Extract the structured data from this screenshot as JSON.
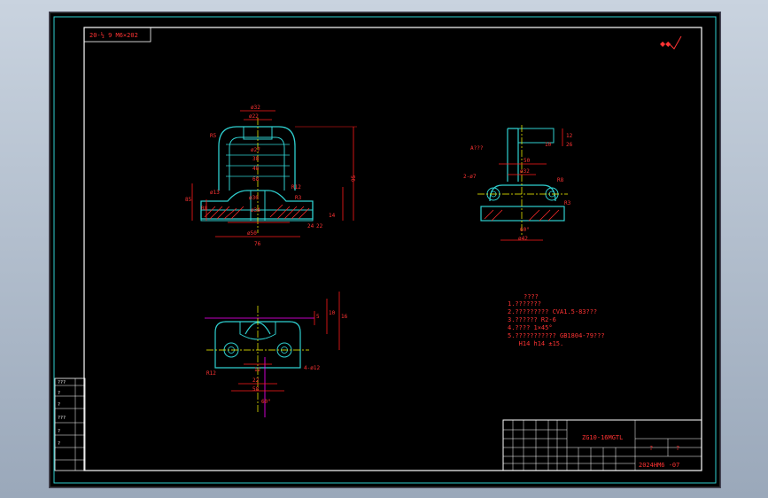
{
  "stamp_top_left": "20-½ 9 M6×202",
  "roughness_mark": "∇",
  "front_view": {
    "dims": [
      "ø32",
      "ø22",
      "ø27",
      "38",
      "48",
      "68",
      "ø50",
      "76",
      "R5",
      "R12",
      "ø13",
      "ø30",
      "R3",
      "R8",
      "95",
      "14",
      "85",
      "24",
      "ø34",
      "22"
    ]
  },
  "side_view": {
    "dims": [
      "50",
      "ø32",
      "2-ø7",
      "R8",
      "R3",
      "ø42",
      "60°",
      "12",
      "26",
      "10"
    ],
    "label": "A???"
  },
  "top_view": {
    "dims": [
      "5",
      "10",
      "16",
      "R12",
      "12",
      "22",
      "58",
      "4-ø12",
      "60°"
    ]
  },
  "notes": {
    "title": "????",
    "lines": [
      "1.???????",
      "2.????????? CVA1.5-83???",
      "3.?????? R2-6",
      "4.???? 1×45°",
      "5.??????????? GB1804-79???",
      "   H14 h14 ±15."
    ]
  },
  "title_block": {
    "part_code": "ZG10-16MGTL",
    "qmarks": [
      "?",
      "?"
    ],
    "drawing_no": "2024HM6 -07",
    "left_col": [
      "???",
      "?",
      "?",
      "???",
      "?",
      "?"
    ]
  },
  "colors": {
    "frame": "#2fd0d0",
    "outline": "#2fd0d0",
    "dimension": "#ff1a1a",
    "center": "#ffff00",
    "notes": "#ff3333",
    "hatch": "#ff2a2a",
    "magenta": "#ff00ff",
    "white": "#ffffff"
  }
}
